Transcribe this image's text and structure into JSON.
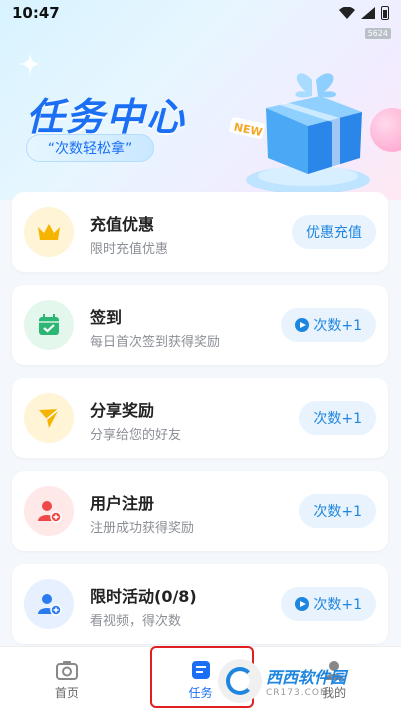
{
  "status": {
    "time": "10:47"
  },
  "build_tag": "5624",
  "hero": {
    "title": "任务中心",
    "pill": "“次数轻松拿”",
    "gift_badge": "NEW"
  },
  "tasks": [
    {
      "title": "充值优惠",
      "subtitle": "限时充值优惠",
      "button": "优惠充值",
      "play": false,
      "icon": "crown-icon",
      "icon_bg": "#fff4d6",
      "icon_color": "#f5b400"
    },
    {
      "title": "签到",
      "subtitle": "每日首次签到获得奖励",
      "button": "次数+1",
      "play": true,
      "icon": "calendar-check-icon",
      "icon_bg": "#e4f7ec",
      "icon_color": "#2bb673"
    },
    {
      "title": "分享奖励",
      "subtitle": "分享给您的好友",
      "button": "次数+1",
      "play": false,
      "icon": "send-icon",
      "icon_bg": "#fff4d6",
      "icon_color": "#f5b400"
    },
    {
      "title": "用户注册",
      "subtitle": "注册成功获得奖励",
      "button": "次数+1",
      "play": false,
      "icon": "user-add-icon",
      "icon_bg": "#ffe8e8",
      "icon_color": "#f04848"
    },
    {
      "title": "限时活动(0/8)",
      "subtitle": "看视频，得次数",
      "button": "次数+1",
      "play": true,
      "icon": "user-add-icon",
      "icon_bg": "#e6f0ff",
      "icon_color": "#2b7bf0"
    }
  ],
  "tabs": [
    {
      "label": "首页",
      "icon": "camera-icon",
      "active": false
    },
    {
      "label": "任务",
      "icon": "task-icon",
      "active": true
    },
    {
      "label": "我的",
      "icon": "user-icon",
      "active": false
    }
  ],
  "watermark": {
    "text": "西西软件园",
    "sub": "CR173.COM"
  },
  "accent": "#1a6ff5"
}
